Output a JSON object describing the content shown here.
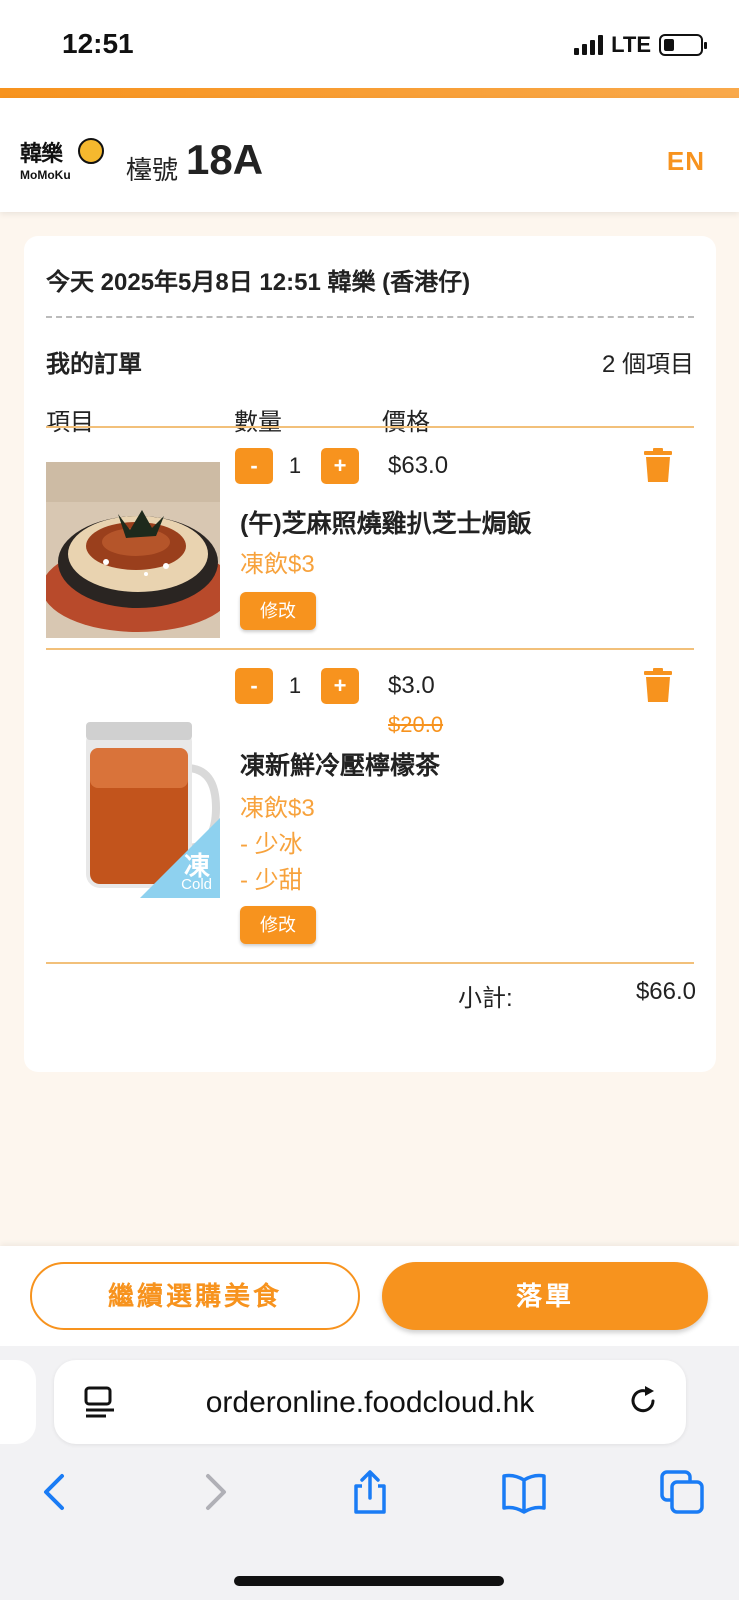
{
  "status": {
    "time": "12:51",
    "network": "LTE",
    "battery_level": 0.3
  },
  "header": {
    "logo_cn": "韓樂",
    "logo_en": "MoMoKu",
    "table_label": "檯號",
    "table_number": "18A",
    "lang_toggle": "EN"
  },
  "order": {
    "date_line": "今天 2025年5月8日 12:51 韓樂 (香港仔)",
    "title": "我的訂單",
    "count": "2 個項目",
    "columns": {
      "item": "項目",
      "qty": "數量",
      "price": "價格"
    },
    "items": [
      {
        "name": "(午)芝麻照燒雞扒芝士焗飯",
        "qty": "1",
        "price": "$63.0",
        "options": [
          "凍飲$3"
        ],
        "edit": "修改"
      },
      {
        "name": "凍新鮮冷壓檸檬茶",
        "qty": "1",
        "price": "$3.0",
        "old_price": "$20.0",
        "options": [
          "凍飲$3",
          "- 少冰",
          "- 少甜"
        ],
        "badge_cn": "凍",
        "badge_en": "Cold",
        "edit": "修改"
      }
    ],
    "minus": "-",
    "plus": "+",
    "subtotal_label": "小計:",
    "subtotal_value": "$66.0"
  },
  "actions": {
    "continue": "繼續選購美食",
    "submit": "落單"
  },
  "browser": {
    "url": "orderonline.foodcloud.hk"
  },
  "colors": {
    "accent": "#f7931e",
    "option": "#f7a23c",
    "page_bg": "#fdf6ee"
  }
}
